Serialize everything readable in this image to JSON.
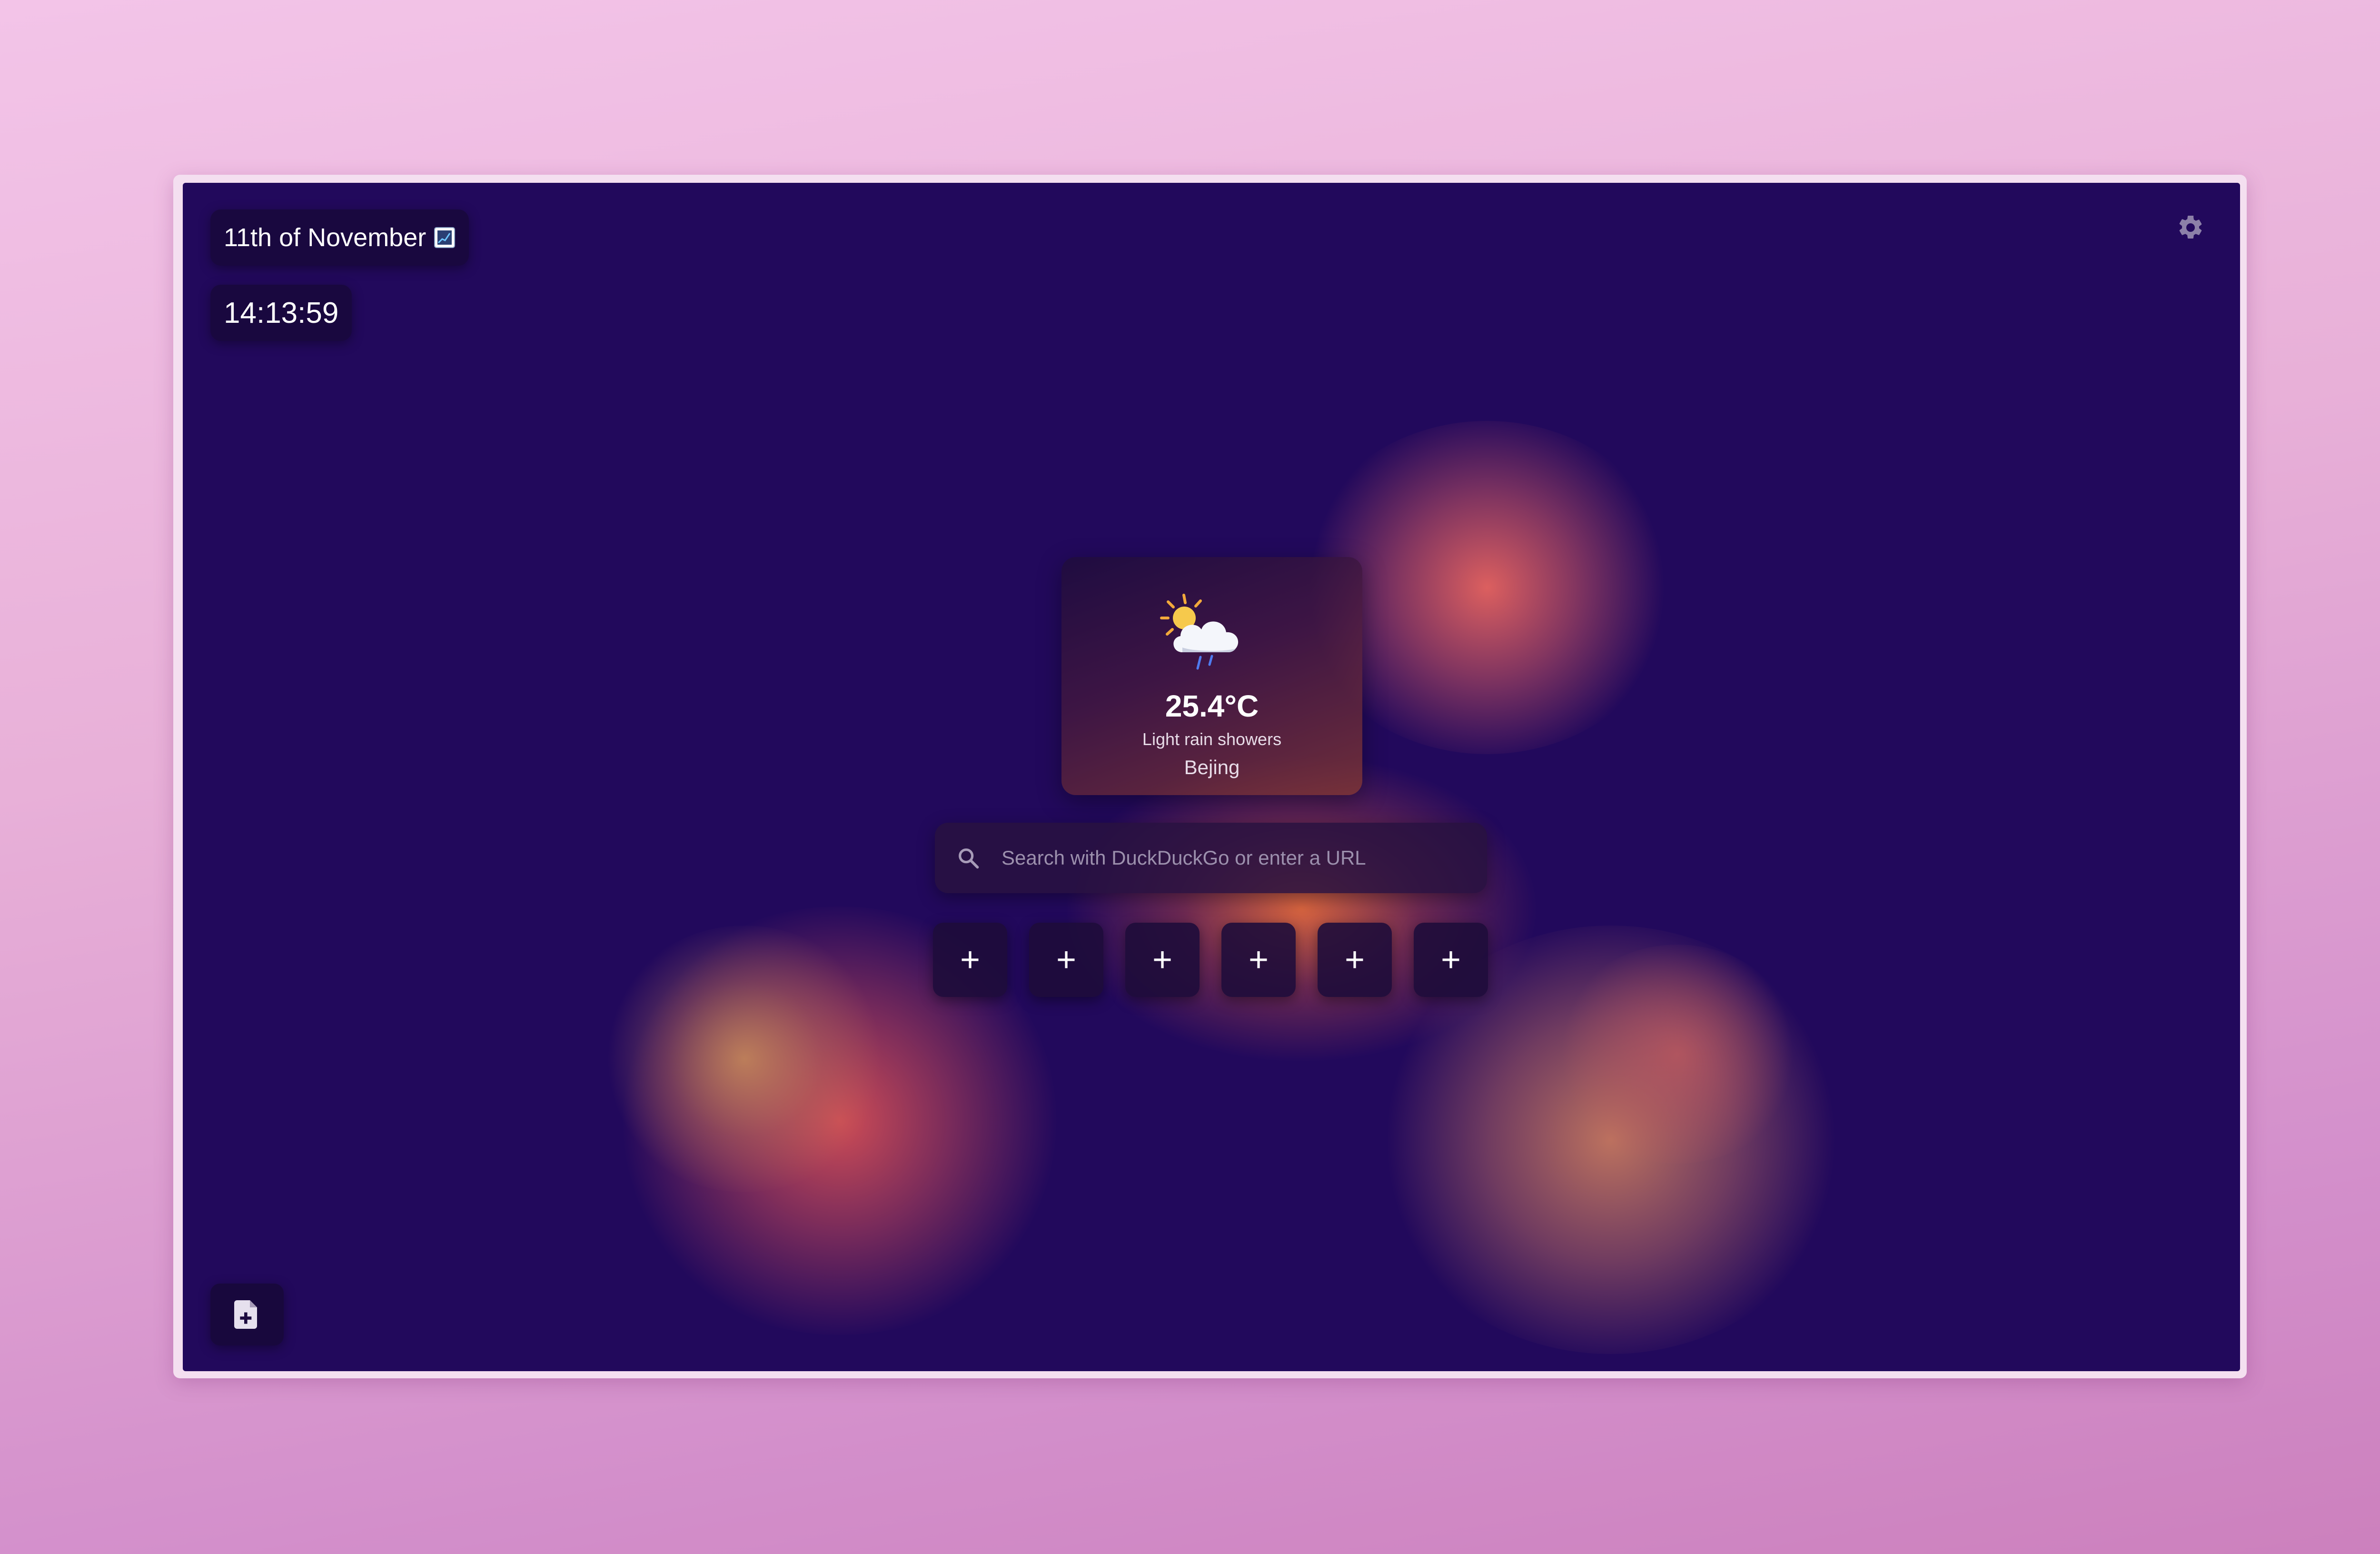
{
  "header": {
    "date": "11th of November",
    "date_icon": "chart-increasing-icon",
    "time": "14:13:59",
    "settings_icon": "gear-icon"
  },
  "weather": {
    "icon": "sun-behind-rain-cloud-icon",
    "temperature": "25.4°C",
    "condition": "Light rain showers",
    "city": "Bejing"
  },
  "search": {
    "icon": "search-icon",
    "placeholder": "Search with DuckDuckGo or enter a URL",
    "value": ""
  },
  "shortcuts": [
    {
      "label": "+"
    },
    {
      "label": "+"
    },
    {
      "label": "+"
    },
    {
      "label": "+"
    },
    {
      "label": "+"
    },
    {
      "label": "+"
    }
  ],
  "footer": {
    "note_icon": "add-document-icon"
  },
  "colors": {
    "background": "#22095c",
    "accent_warm": "#e0645f"
  }
}
